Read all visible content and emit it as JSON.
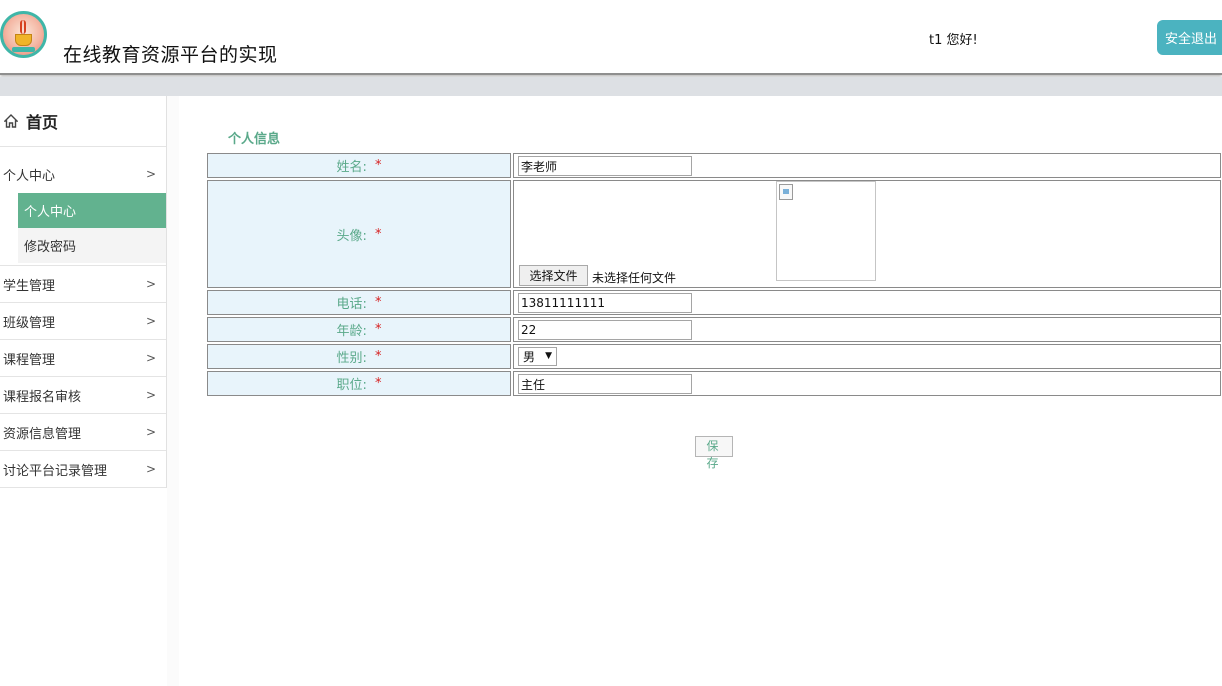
{
  "header": {
    "title": "在线教育资源平台的实现",
    "greeting": "t1 您好!",
    "logout_label": "安全退出",
    "logo_icon": "teacup-logo-icon"
  },
  "sidebar": {
    "home_label": "首页",
    "home_icon": "home-icon",
    "items": [
      {
        "label": "个人中心",
        "chevron": ">"
      },
      {
        "label": "学生管理",
        "chevron": ">"
      },
      {
        "label": "班级管理",
        "chevron": ">"
      },
      {
        "label": "课程管理",
        "chevron": ">"
      },
      {
        "label": "课程报名审核",
        "chevron": ">"
      },
      {
        "label": "资源信息管理",
        "chevron": ">"
      },
      {
        "label": "讨论平台记录管理",
        "chevron": ">"
      }
    ],
    "submenu": [
      {
        "label": "个人中心",
        "active": true
      },
      {
        "label": "修改密码",
        "active": false
      }
    ]
  },
  "form": {
    "section_title": "个人信息",
    "required_mark": "*",
    "fields": {
      "name": {
        "label": "姓名:",
        "value": "李老师"
      },
      "avatar": {
        "label": "头像:",
        "file_button": "选择文件",
        "file_status": "未选择任何文件"
      },
      "phone": {
        "label": "电话:",
        "value": "13811111111"
      },
      "age": {
        "label": "年龄:",
        "value": "22"
      },
      "gender": {
        "label": "性别:",
        "value": "男"
      },
      "position": {
        "label": "职位:",
        "value": "主任"
      }
    },
    "save_label": "保 存"
  },
  "colors": {
    "accent_green": "#62b28f",
    "label_text": "#5aa98a",
    "logout_bg": "#4bb3c0",
    "label_bg": "#e8f4fb",
    "required": "#d62020"
  }
}
